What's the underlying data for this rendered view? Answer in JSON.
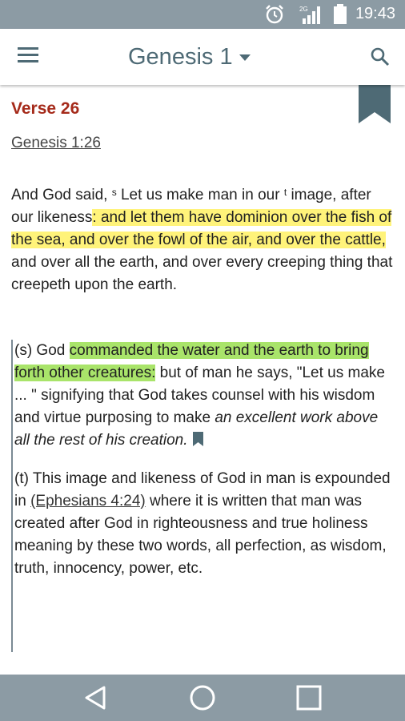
{
  "status_bar": {
    "time": "19:43",
    "network": "2G",
    "icons": [
      "alarm-icon",
      "signal-icon",
      "battery-icon"
    ]
  },
  "app_bar": {
    "title": "Genesis 1",
    "icons": [
      "menu-icon",
      "caret-down-icon",
      "search-icon"
    ]
  },
  "content": {
    "verse_heading": "Verse 26",
    "reference": "Genesis 1:26",
    "verse": {
      "part1": "And God said,",
      "note_s": "s",
      "part2": "Let us make man in our",
      "note_t": "t",
      "part3": "image, after our likeness",
      "highlight": ": and let them have dominion over the fish of the sea, and over the fowl of the air, and over the cattle,",
      "part4": "and over all the earth, and over every creeping thing that creepeth upon the earth."
    },
    "notes": [
      {
        "prefix": "(s) God",
        "highlight": "commanded the water and the earth to bring forth other creatures:",
        "text": "but of man he says, \"Let us make ... \" signifying that God takes counsel with his wisdom and virtue purposing to make",
        "italic": "an excellent work above all the rest of his creation."
      },
      {
        "prefix": "(t) This image and likeness of God in man is expounded in",
        "link": "(Ephesians 4:24)",
        "text": "where it is written that man was created after God in righteousness and true holiness meaning by these two words, all perfection, as wisdom, truth, innocency, power, etc."
      }
    ]
  },
  "colors": {
    "status_bar": "#8c9ba4",
    "accent": "#4e6a75",
    "verse_heading": "#a52a1a",
    "highlight_yellow": "#fff37a",
    "highlight_green": "#a9e46a"
  },
  "nav_bar": {
    "icons": [
      "back-icon",
      "home-icon",
      "recents-icon"
    ]
  }
}
